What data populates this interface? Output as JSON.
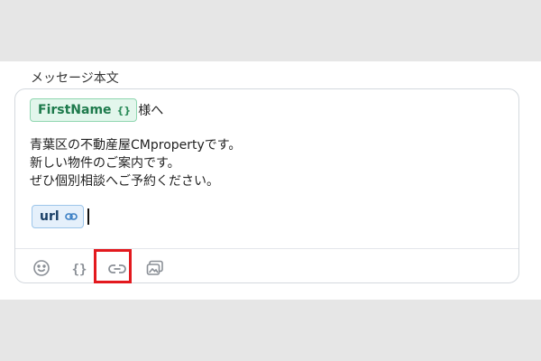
{
  "field": {
    "label": "メッセージ本文"
  },
  "message": {
    "variable_chip": {
      "label": "FirstName",
      "braces": "{}"
    },
    "after_variable": "様へ",
    "lines": [
      "青葉区の不動産屋CMpropertyです。",
      "新しい物件のご案内です。",
      "ぜひ個別相談へご予約ください。"
    ],
    "url_chip": {
      "label": "url"
    }
  },
  "toolbar": {
    "items": [
      {
        "icon": "emoji-icon"
      },
      {
        "icon": "variable-braces-icon",
        "glyph": "{}"
      },
      {
        "icon": "link-icon",
        "highlighted": true
      },
      {
        "icon": "image-icon"
      }
    ]
  },
  "colors": {
    "highlight": "#e3191e",
    "variable_chip_bg": "#e3f6ec",
    "variable_chip_text": "#1e7a4c",
    "url_chip_bg": "#e5f0fb",
    "url_chip_text": "#1a3f66"
  }
}
